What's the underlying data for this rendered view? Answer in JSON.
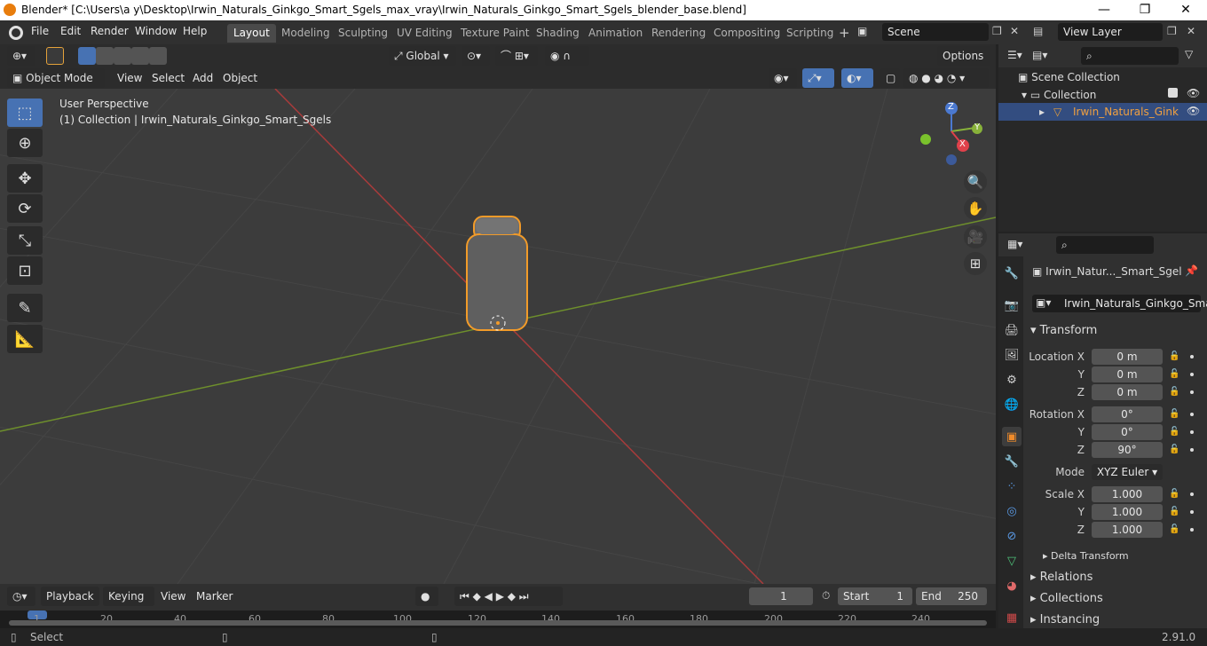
{
  "window": {
    "title": "Blender* [C:\\Users\\a y\\Desktop\\Irwin_Naturals_Ginkgo_Smart_Sgels_max_vray\\Irwin_Naturals_Ginkgo_Smart_Sgels_blender_base.blend]",
    "minimize": "—",
    "maximize": "❐",
    "close": "✕"
  },
  "menus": [
    "File",
    "Edit",
    "Render",
    "Window",
    "Help"
  ],
  "workspaces": [
    "Layout",
    "Modeling",
    "Sculpting",
    "UV Editing",
    "Texture Paint",
    "Shading",
    "Animation",
    "Rendering",
    "Compositing",
    "Scripting"
  ],
  "add_tab": "+",
  "scene": {
    "name": "Scene",
    "view_layer": "View Layer"
  },
  "viewport_header": {
    "mode": "Object Mode",
    "view": "View",
    "select": "Select",
    "add": "Add",
    "object": "Object",
    "transform": "Global",
    "options": "Options"
  },
  "viewport": {
    "perspective": "User Perspective",
    "collection_info": "(1) Collection | Irwin_Naturals_Ginkgo_Smart_Sgels"
  },
  "gizmo": {
    "x": "X",
    "y": "Y",
    "z": "Z"
  },
  "outliner": {
    "scene_collection": "Scene Collection",
    "collection": "Collection",
    "object": "Irwin_Naturals_Ginkgo_Smart_Sgels",
    "object_short": "Irwin_Naturals_Ginkı"
  },
  "properties": {
    "object_name": "Irwin_Natur..._Smart_Sgel",
    "data_name": "Irwin_Naturals_Ginkgo_Sma...",
    "transform_title": "Transform",
    "location": {
      "label": "Location X",
      "x": "0 m",
      "y": "0 m",
      "z": "0 m"
    },
    "rotation": {
      "label": "Rotation X",
      "x": "0°",
      "y": "0°",
      "z": "90°"
    },
    "mode": {
      "label": "Mode",
      "value": "XYZ Euler"
    },
    "scale": {
      "label": "Scale X",
      "x": "1.000",
      "y": "1.000",
      "z": "1.000"
    },
    "axis_y": "Y",
    "axis_z": "Z",
    "delta": "Delta Transform",
    "relations": "Relations",
    "collections": "Collections",
    "instancing": "Instancing"
  },
  "timeline": {
    "playback": "Playback",
    "keying": "Keying",
    "view": "View",
    "marker": "Marker",
    "current_frame": "1",
    "start_label": "Start",
    "start": "1",
    "end_label": "End",
    "end": "250",
    "ticks": [
      "1",
      "20",
      "40",
      "60",
      "80",
      "100",
      "120",
      "140",
      "160",
      "180",
      "200",
      "220",
      "240"
    ]
  },
  "statusbar": {
    "select": "Select",
    "version": "2.91.0"
  }
}
